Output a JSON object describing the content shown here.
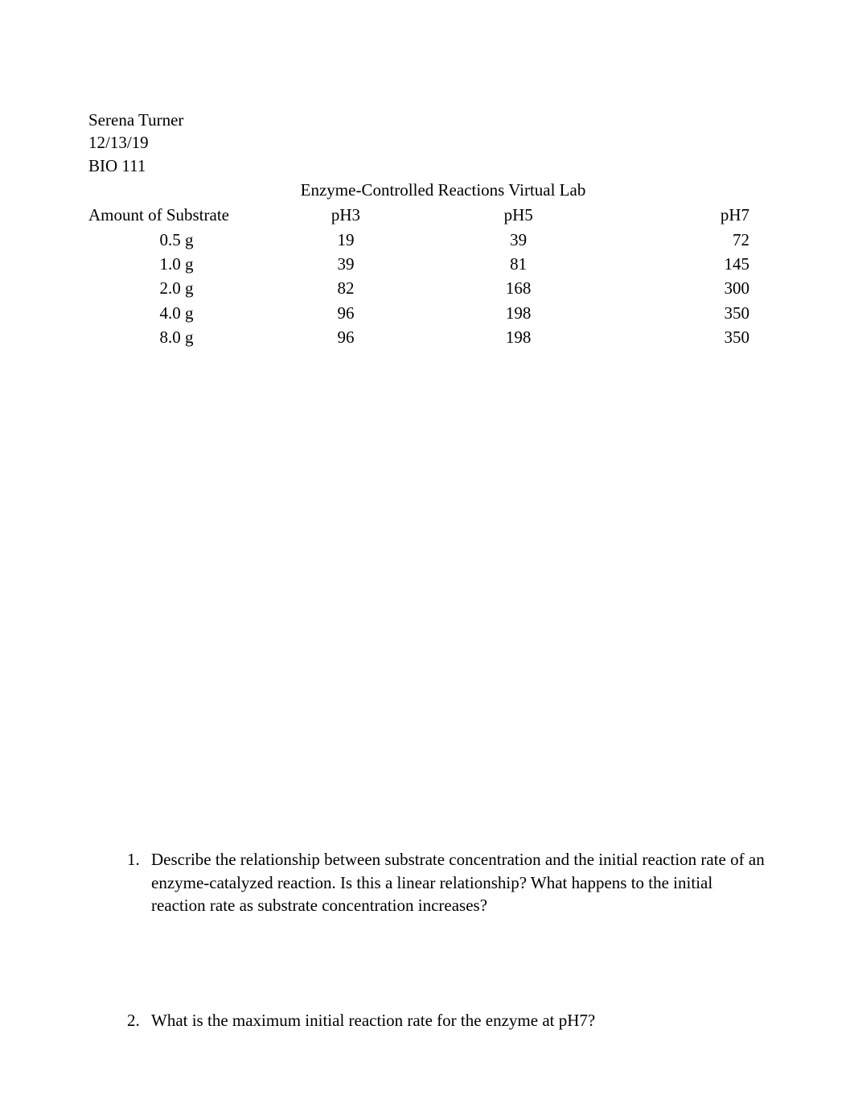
{
  "header": {
    "name": "Serena Turner",
    "date": "12/13/19",
    "course": "BIO 111"
  },
  "title": "Enzyme-Controlled Reactions Virtual Lab",
  "table": {
    "columns": [
      "Amount of Substrate",
      "pH3",
      "pH5",
      "pH7"
    ],
    "rows": [
      {
        "substrate": "0.5 g",
        "ph3": "19",
        "ph5": "39",
        "ph7": "72"
      },
      {
        "substrate": "1.0 g",
        "ph3": "39",
        "ph5": "81",
        "ph7": "145"
      },
      {
        "substrate": "2.0 g",
        "ph3": "82",
        "ph5": "168",
        "ph7": "300"
      },
      {
        "substrate": "4.0 g",
        "ph3": "96",
        "ph5": "198",
        "ph7": "350"
      },
      {
        "substrate": "8.0 g",
        "ph3": "96",
        "ph5": "198",
        "ph7": "350"
      }
    ]
  },
  "questions": [
    {
      "number": "1.",
      "text": "Describe the relationship between substrate concentration and the initial reaction rate of an enzyme-catalyzed reaction. Is this a linear relationship? What happens to the initial reaction rate as substrate concentration increases?"
    },
    {
      "number": "2.",
      "text": "What is the maximum initial reaction rate for the enzyme at pH7?"
    }
  ],
  "chart_data": {
    "type": "table",
    "title": "Enzyme-Controlled Reactions Virtual Lab",
    "columns": [
      "Amount of Substrate",
      "pH3",
      "pH5",
      "pH7"
    ],
    "rows": [
      [
        "0.5 g",
        19,
        39,
        72
      ],
      [
        "1.0 g",
        39,
        81,
        145
      ],
      [
        "2.0 g",
        82,
        168,
        300
      ],
      [
        "4.0 g",
        96,
        198,
        350
      ],
      [
        "8.0 g",
        96,
        198,
        350
      ]
    ]
  }
}
